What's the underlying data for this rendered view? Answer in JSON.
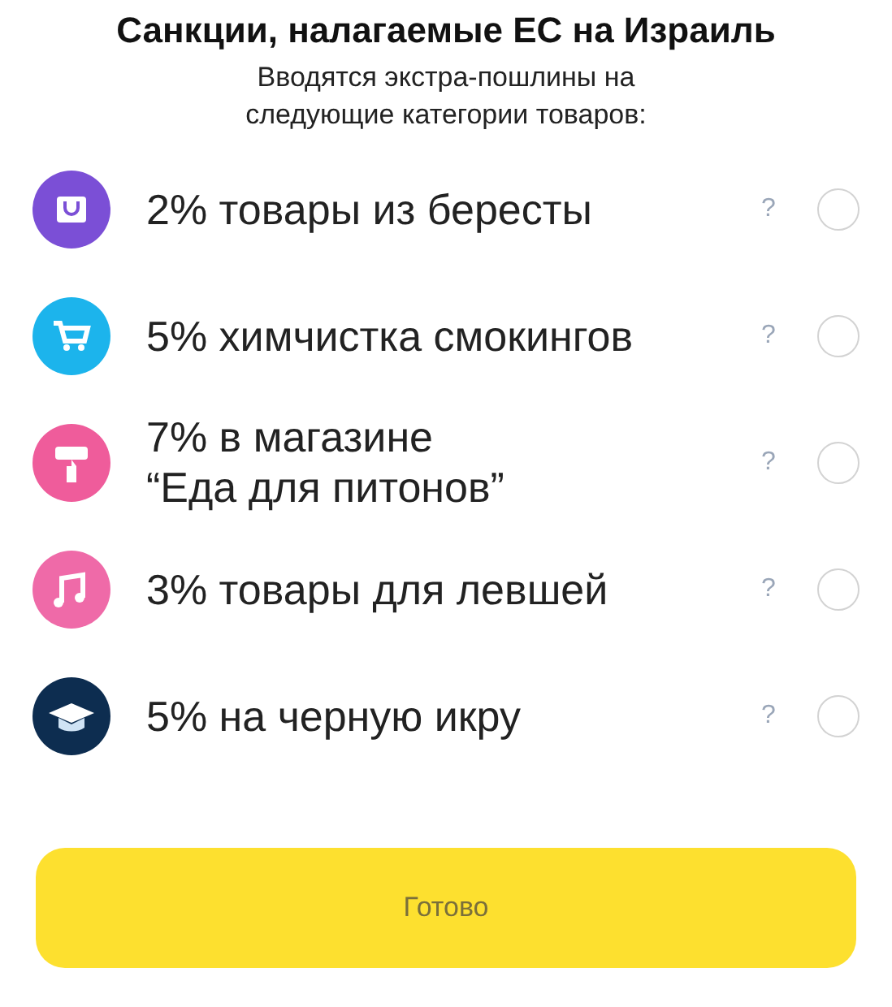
{
  "title": "Санкции, налагаемые ЕС на Израиль",
  "subtitle": "Вводятся экстра-пошлины на\nследующие категории товаров:",
  "options": [
    {
      "kind": "bag",
      "color": "#7b4fd6",
      "label": "2% товары из бересты",
      "help": "?",
      "selected": false
    },
    {
      "kind": "cart",
      "color": "#1cb4ec",
      "label": "5% химчистка смокингов",
      "help": "?",
      "selected": false
    },
    {
      "kind": "roller",
      "color": "#ef5c9b",
      "label": "7% в магазине\n“Еда для питонов”",
      "help": "?",
      "selected": false
    },
    {
      "kind": "music",
      "color": "#ef6aa8",
      "label": "3% товары для левшей",
      "help": "?",
      "selected": false
    },
    {
      "kind": "cap",
      "color": "#0d2d50",
      "label": "5% на черную икру",
      "help": "?",
      "selected": false
    }
  ],
  "button": "Готово"
}
